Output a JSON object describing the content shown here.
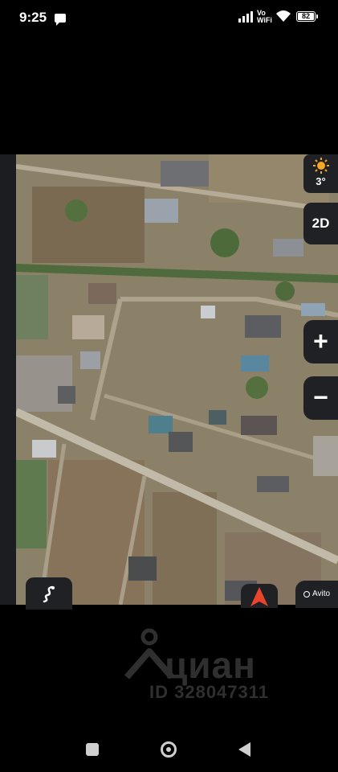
{
  "status_bar": {
    "time": "9:25",
    "network_label_top": "Vo",
    "network_label_bottom": "WiFi",
    "battery": "82"
  },
  "map": {
    "weather_temp": "3°",
    "mode_label": "2D",
    "zoom_in_label": "+",
    "zoom_out_label": "−",
    "attribution": "Avito",
    "icons": [
      "sun-icon",
      "route-icon",
      "compass-arrow-icon"
    ]
  },
  "watermark": {
    "brand": "циан",
    "listing_id": "ID 328047311"
  },
  "colors": {
    "control_bg": "#1f2124",
    "sun": "#f5a623",
    "compass": "#e8452c",
    "watermark": "#2f2f2f"
  }
}
